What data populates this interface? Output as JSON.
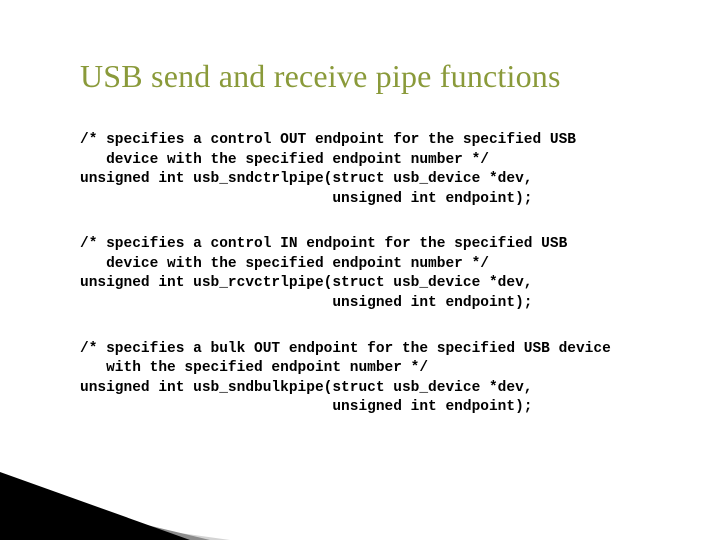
{
  "title": "USB send and receive pipe functions",
  "blocks": {
    "b1": "/* specifies a control OUT endpoint for the specified USB\n   device with the specified endpoint number */\nunsigned int usb_sndctrlpipe(struct usb_device *dev,\n                             unsigned int endpoint);",
    "b2": "/* specifies a control IN endpoint for the specified USB\n   device with the specified endpoint number */\nunsigned int usb_rcvctrlpipe(struct usb_device *dev,\n                             unsigned int endpoint);",
    "b3": "/* specifies a bulk OUT endpoint for the specified USB device\n   with the specified endpoint number */\nunsigned int usb_sndbulkpipe(struct usb_device *dev,\n                             unsigned int endpoint);"
  }
}
